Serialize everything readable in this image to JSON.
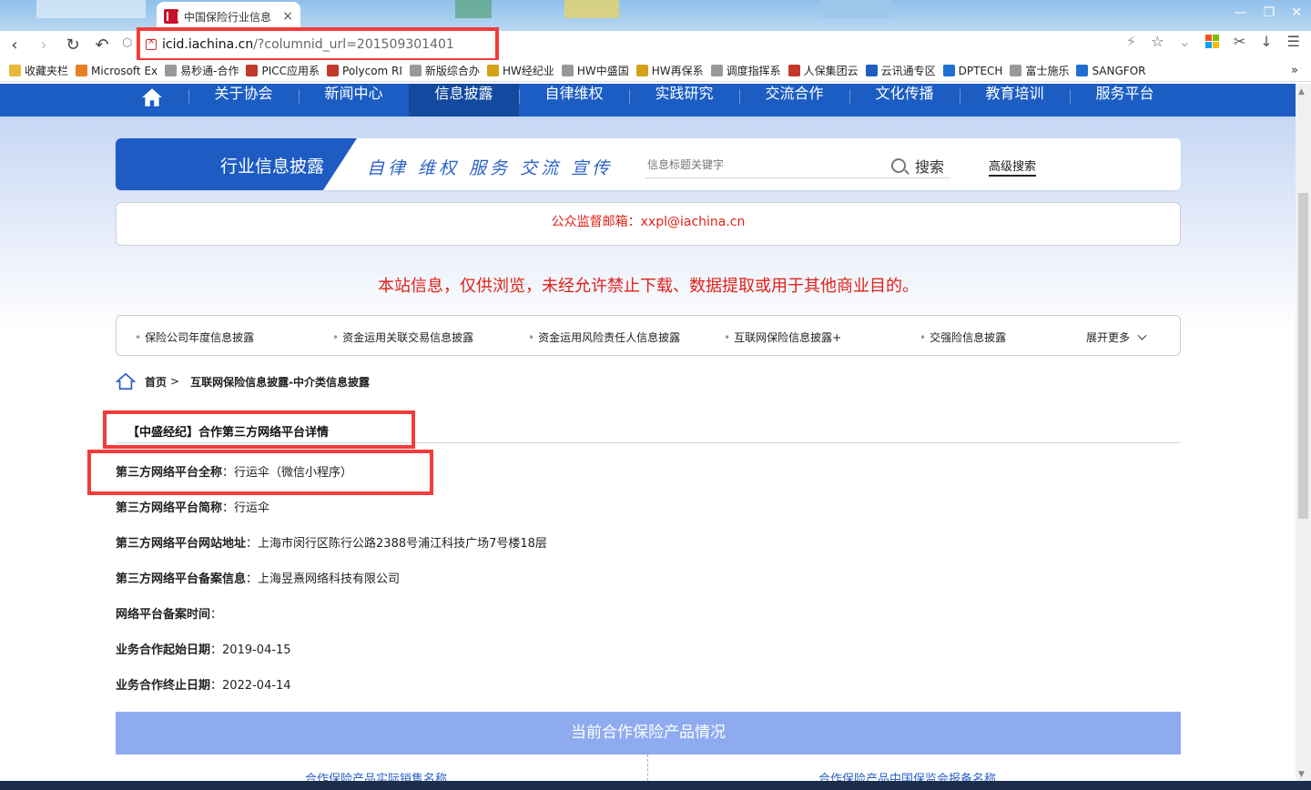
{
  "browser": {
    "tab_title": "中国保险行业信息",
    "tab_close": "×",
    "address_domain": "icid.iachina.cn",
    "address_path": "/?columnid_url=201509301401",
    "bookmarks": [
      {
        "label": "收藏夹栏",
        "icon": "folder-icon",
        "color": "#e8b83a"
      },
      {
        "label": "Microsoft Ex",
        "icon": "office-icon",
        "color": "#e67e22"
      },
      {
        "label": "易秒通-合作",
        "icon": "page-icon",
        "color": "#999999"
      },
      {
        "label": "PICC应用系",
        "icon": "picc-icon",
        "color": "#c0392b"
      },
      {
        "label": "Polycom RI",
        "icon": "polycom-icon",
        "color": "#c0392b"
      },
      {
        "label": "新版综合办",
        "icon": "page-icon",
        "color": "#999999"
      },
      {
        "label": "HW经纪业",
        "icon": "hw-icon",
        "color": "#d4a017"
      },
      {
        "label": "HW中盛国",
        "icon": "page-icon",
        "color": "#999999"
      },
      {
        "label": "HW再保系",
        "icon": "hw-icon",
        "color": "#d4a017"
      },
      {
        "label": "调度指挥系",
        "icon": "page-icon",
        "color": "#999999"
      },
      {
        "label": "人保集团云",
        "icon": "picc-icon",
        "color": "#c0392b"
      },
      {
        "label": "云讯通专区",
        "icon": "cloud-icon",
        "color": "#1f5fbf"
      },
      {
        "label": "DPTECH",
        "icon": "dp-icon",
        "color": "#1f6fd1"
      },
      {
        "label": "富士施乐",
        "icon": "page-icon",
        "color": "#999999"
      },
      {
        "label": "SANGFOR",
        "icon": "dp-icon",
        "color": "#1f6fd1"
      }
    ],
    "bookmarks_more": "»"
  },
  "site_nav": {
    "items": [
      "关于协会",
      "新闻中心",
      "信息披露",
      "自律维权",
      "实践研究",
      "交流合作",
      "文化传播",
      "教育培训",
      "服务平台"
    ],
    "active": "信息披露",
    "accent": "#1c5dc3"
  },
  "search_panel": {
    "title": "行业信息披露",
    "slogan": "自律 维权 服务 交流 宣传",
    "placeholder": "信息标题关键字",
    "search_label": "搜索",
    "advanced_label": "高级搜索"
  },
  "notice": "公众监督邮箱：xxpl@iachina.cn",
  "disclaimer": "本站信息，仅供浏览，未经允许禁止下载、数据提取或用于其他商业目的。",
  "categories": {
    "items": [
      "保险公司年度信息披露",
      "资金运用关联交易信息披露",
      "资金运用风险责任人信息披露",
      "互联网保险信息披露+",
      "交强险信息披露"
    ],
    "more_label": "展开更多"
  },
  "breadcrumb": {
    "home": "首页",
    "sep": ">",
    "current": "互联网保险信息披露-中介类信息披露"
  },
  "detail": {
    "title": "【中盛经纪】合作第三方网络平台详情",
    "fields": [
      {
        "key": "第三方网络平台全称",
        "value": "行运伞（微信小程序）"
      },
      {
        "key": "第三方网络平台简称",
        "value": "行运伞"
      },
      {
        "key": "第三方网络平台网站地址",
        "value": "上海市闵行区陈行公路2388号浦江科技广场7号楼18层"
      },
      {
        "key": "第三方网络平台备案信息",
        "value": "上海昱熹网络科技有限公司"
      },
      {
        "key": "网络平台备案时间",
        "value": ""
      },
      {
        "key": "业务合作起始日期",
        "value": "2019-04-15"
      },
      {
        "key": "业务合作终止日期",
        "value": "2022-04-14"
      }
    ],
    "colon": "："
  },
  "products_table": {
    "header": "当前合作保险产品情况",
    "columns": [
      "合作保险产品实际销售名称",
      "合作保险产品中国保监会报备名称"
    ]
  },
  "colors": {
    "highlight": "#f43b3b",
    "notice_red": "#e0211a",
    "table_header": "#8eabf0"
  }
}
